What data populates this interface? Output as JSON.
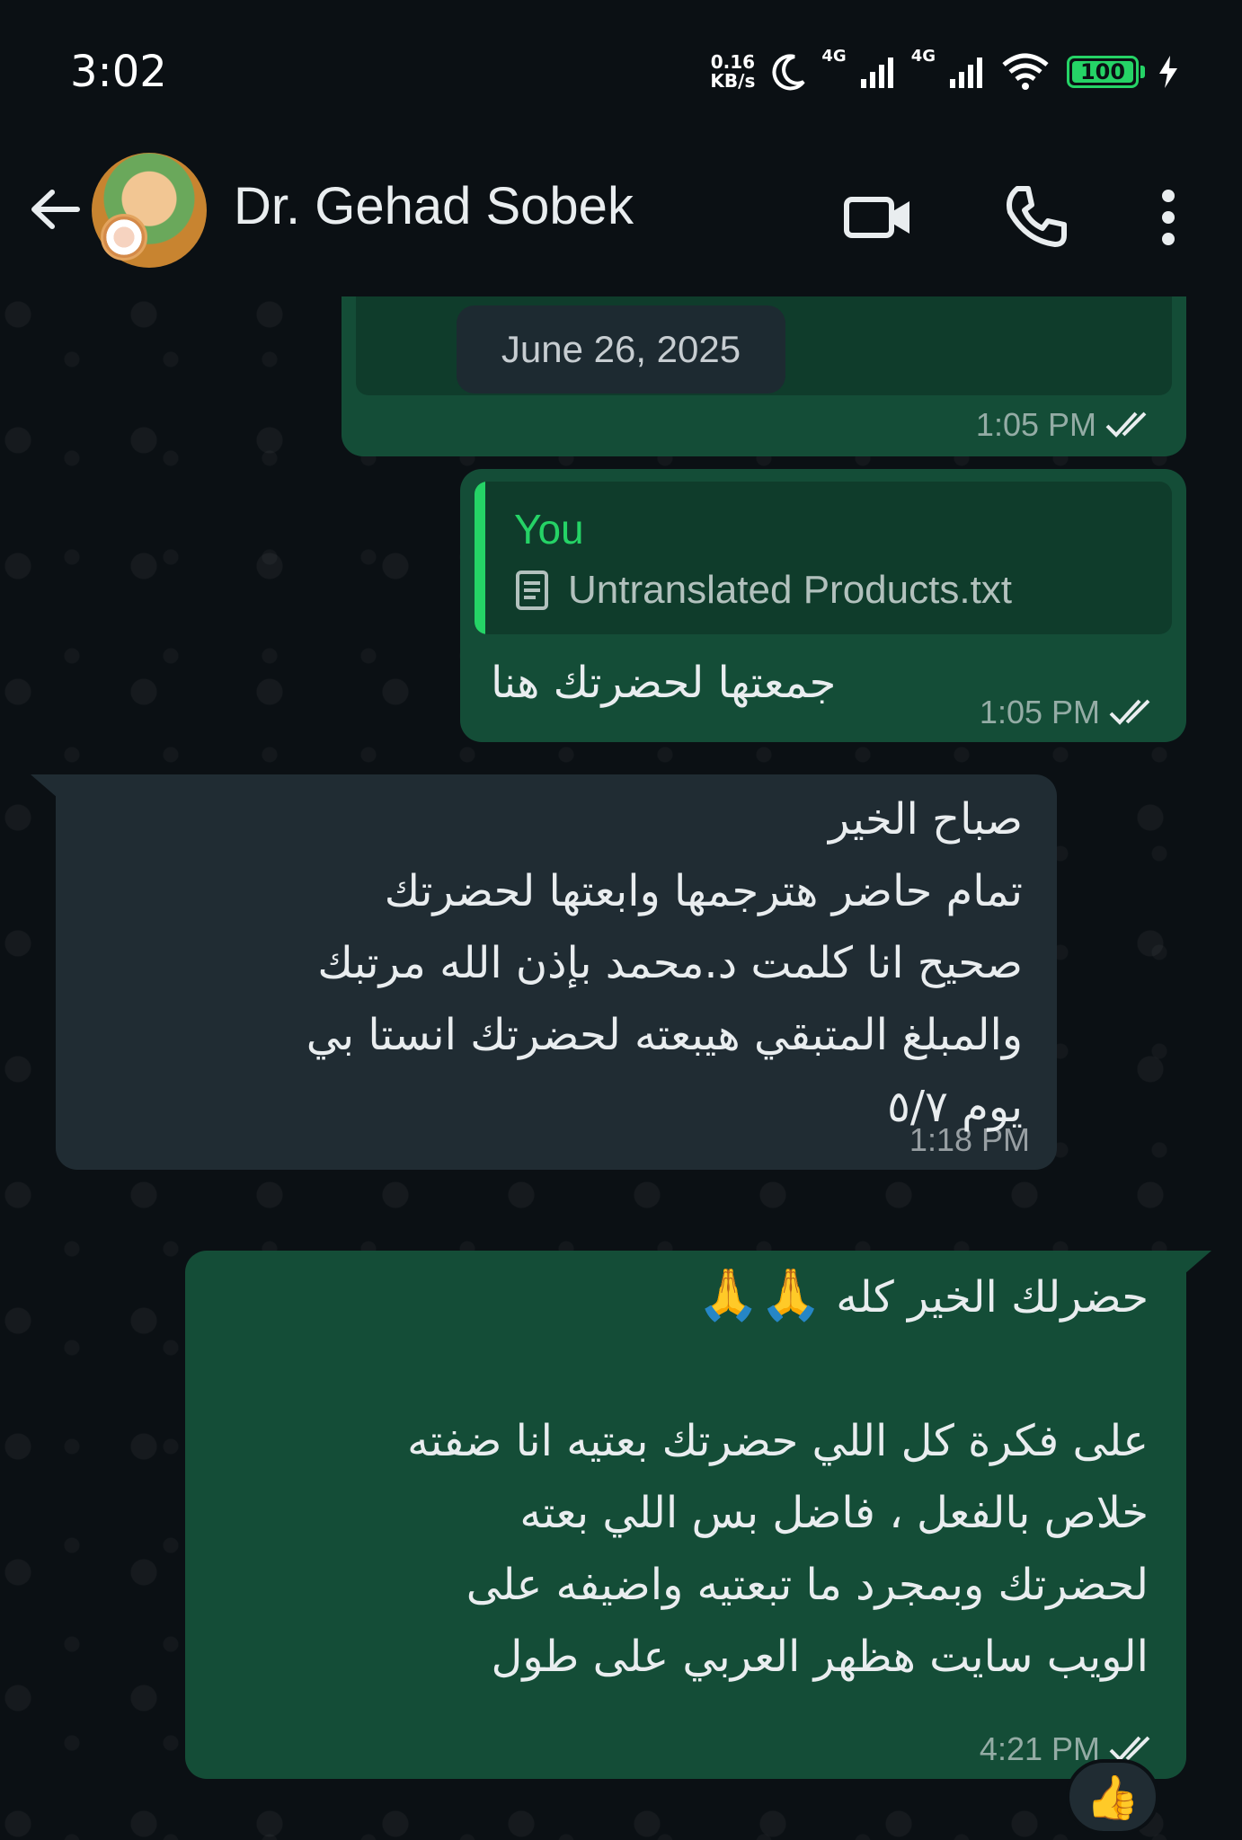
{
  "status_bar": {
    "time": "3:02",
    "net_speed_value": "0.16",
    "net_speed_unit": "KB/s",
    "sim1_label": "4G",
    "sim2_label": "4G",
    "battery_level": "100",
    "icons": [
      "moon-icon",
      "signal-icon",
      "signal-icon",
      "wifi-icon",
      "battery-icon",
      "charging-icon"
    ]
  },
  "header": {
    "contact_name": "Dr. Gehad Sobek",
    "icons": [
      "back-arrow-icon",
      "video-call-icon",
      "phone-icon",
      "more-vert-icon"
    ]
  },
  "chat": {
    "messages": [
      {
        "direction": "outgoing",
        "date_chip": "June 26, 2025",
        "time": "1:05 PM",
        "status": "read"
      },
      {
        "direction": "outgoing",
        "quote_author": "You",
        "quote_file": "Untranslated Products.txt",
        "text": "جمعتها لحضرتك هنا",
        "time": "1:05 PM",
        "status": "read"
      },
      {
        "direction": "incoming",
        "lines": [
          "صباح الخير",
          "تمام حاضر هترجمها وابعتها لحضرتك",
          "صحيح انا كلمت د.محمد بإذن الله مرتبك",
          "والمبلغ المتبقي هيبعته لحضرتك انستا بي",
          "يوم ٥/٧"
        ],
        "time": "1:18 PM"
      },
      {
        "direction": "outgoing",
        "first_line": "حضرلك الخير كله",
        "first_line_emoji": "🙏🙏",
        "lines": [
          "على فكرة كل اللي حضرتك بعتيه انا ضفته",
          "خلاص بالفعل ، فاضل بس اللي بعته",
          "لحضرتك وبمجرد ما تبعتيه واضيفه على",
          "الويب سايت هظهر العربي على طول"
        ],
        "time": "4:21 PM",
        "status": "read",
        "reaction": "👍"
      }
    ]
  },
  "colors": {
    "background": "#0b1014",
    "outgoing_bubble": "#144d37",
    "incoming_bubble": "#202c33",
    "accent_green": "#25d366",
    "read_tick": "#e9edef"
  }
}
